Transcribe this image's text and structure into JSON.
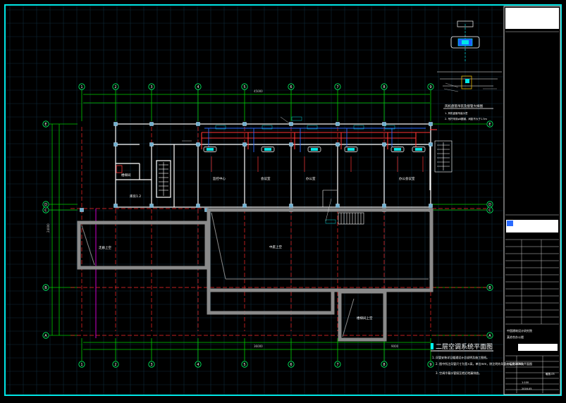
{
  "drawing": {
    "title": "二层空调系统平面图",
    "notes": [
      "1. 风管安装详见暖通设计总说明及施工图纸。",
      "2. 图中所注风管尺寸为宽×高，单位mm，除注明外风管底标高3.000。",
      "3. 空调冷凝水管接至就近地漏排放。"
    ],
    "axes_columns": [
      "1",
      "2",
      "3",
      "4",
      "5",
      "6",
      "7",
      "8",
      "9"
    ],
    "axes_rows": [
      "E",
      "D",
      "C",
      "B",
      "A"
    ],
    "overall_dim_top": "45000",
    "overall_dim_left": "24000",
    "overall_dim_bottom_a": "36000",
    "overall_dim_bottom_b": "9000"
  },
  "rooms": {
    "stair_room": "楼梯间",
    "stair_room_2": "库房1.2",
    "office_1": "监控中心",
    "office_2": "会议室",
    "office_3": "办公室",
    "office_4": "办公会议室",
    "hall_left": "走廊上空",
    "hall_center": "中庭上空",
    "stair_small": "楼梯间上空"
  },
  "detail": {
    "caption": "风机盘管吊装及接管大样图",
    "note_1": "1. 风机盘管吊装示意",
    "note_2": "2. 吊杆采用φ8圆钢，间距不大于1.5m"
  },
  "title_block": {
    "company": "中国建筑设计研究院",
    "project": "某综合办公楼",
    "drawing_name": "二层空调系统平面图",
    "sheet_no": "暖施-05",
    "scale": "1:100",
    "date": "2016.05"
  },
  "colors": {
    "background": "#000000",
    "frame": "#00e6e6",
    "grid": "#00cc00",
    "axis_bubble": "#00ff66",
    "wall": "#ffffff",
    "core": "#8a8a8a",
    "duct": "#ff3333",
    "pipe": "#2266ff",
    "ref_line": "#cc00cc"
  }
}
